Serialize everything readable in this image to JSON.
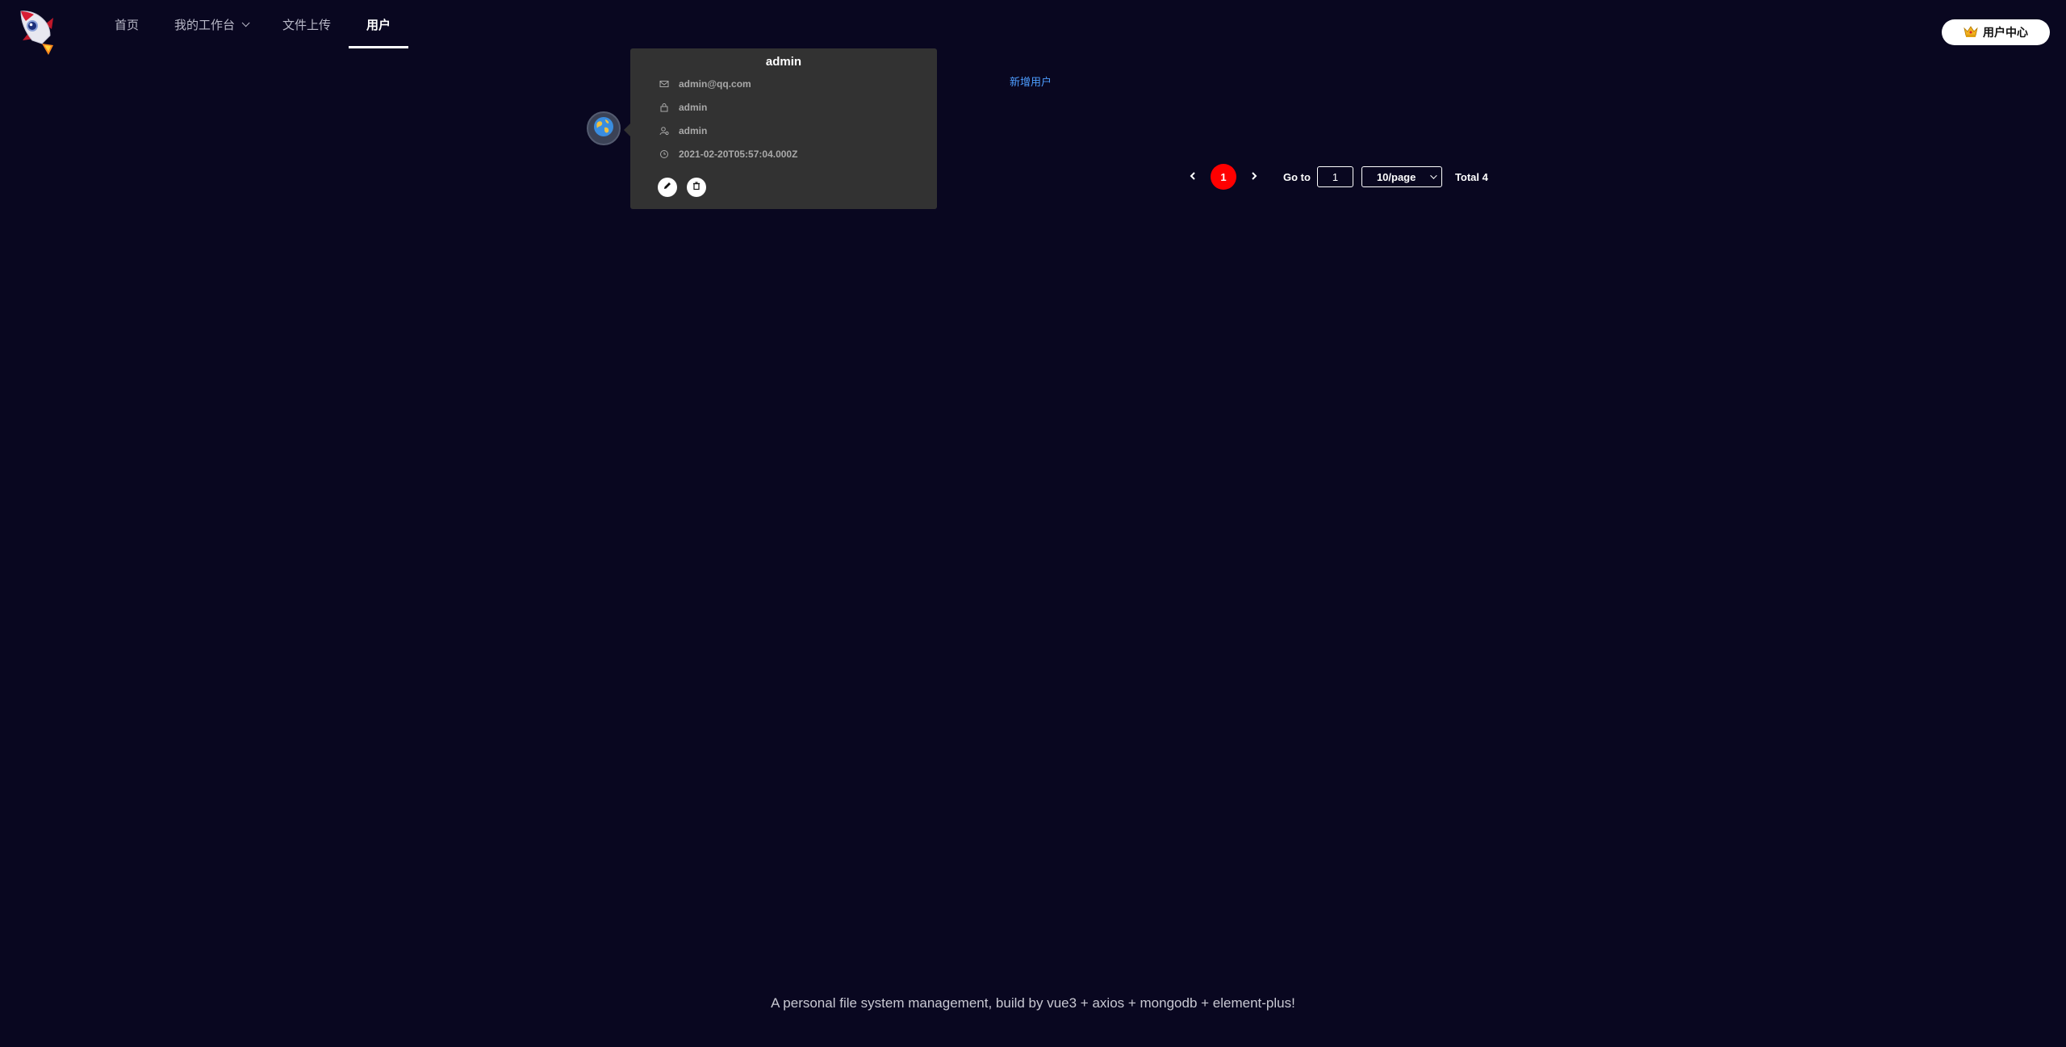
{
  "header": {
    "logo_icon": "rocket-logo-icon",
    "nav": [
      {
        "label": "首页",
        "active": false
      },
      {
        "label": "我的工作台",
        "active": false,
        "has_dropdown": true
      },
      {
        "label": "文件上传",
        "active": false
      },
      {
        "label": "用户",
        "active": true
      }
    ],
    "user_center": {
      "icon": "crown-icon",
      "label": "用户中心"
    }
  },
  "user_card": {
    "avatar_icon": "globe-avatar-icon",
    "title": "admin",
    "rows": [
      {
        "icon": "mail-icon",
        "value": "admin@qq.com"
      },
      {
        "icon": "lock-icon",
        "value": "admin"
      },
      {
        "icon": "user-settings-icon",
        "value": "admin"
      },
      {
        "icon": "clock-icon",
        "value": "2021-02-20T05:57:04.000Z"
      }
    ],
    "actions": [
      {
        "icon": "edit-icon"
      },
      {
        "icon": "delete-icon"
      }
    ]
  },
  "add_user": {
    "label": "新增用户"
  },
  "pagination": {
    "current_page": "1",
    "goto_label": "Go to",
    "goto_value": "1",
    "page_size": "10/page",
    "total": "Total 4"
  },
  "footer": {
    "text": "A personal file system management, build by vue3 + axios + mongodb + element-plus!"
  },
  "colors": {
    "background": "#090720",
    "accent_red": "#ff0000",
    "link_blue": "#4d9dff",
    "card_bg": "#323232"
  }
}
